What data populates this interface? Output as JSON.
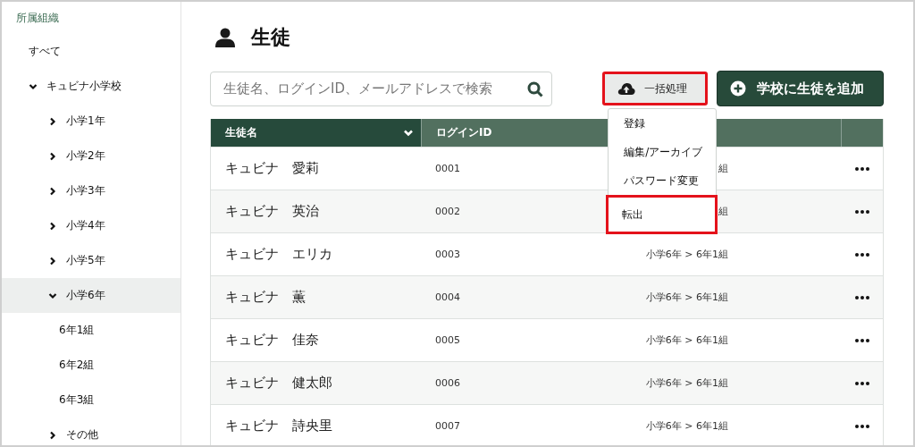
{
  "sidebar": {
    "heading": "所属組織",
    "tree": [
      {
        "label": "すべて",
        "selected": false
      },
      {
        "label": "キュビナ小学校",
        "expanded": true,
        "selected": false,
        "children": [
          {
            "label": "小学1年",
            "expanded": false,
            "selected": false
          },
          {
            "label": "小学2年",
            "expanded": false,
            "selected": false
          },
          {
            "label": "小学3年",
            "expanded": false,
            "selected": false
          },
          {
            "label": "小学4年",
            "expanded": false,
            "selected": false
          },
          {
            "label": "小学5年",
            "expanded": false,
            "selected": false
          },
          {
            "label": "小学6年",
            "expanded": true,
            "selected": true,
            "children": [
              {
                "label": "6年1組",
                "selected": false
              },
              {
                "label": "6年2組",
                "selected": false
              },
              {
                "label": "6年3組",
                "selected": false
              }
            ]
          },
          {
            "label": "その他",
            "expanded": false,
            "selected": false
          }
        ]
      }
    ]
  },
  "page": {
    "title": "生徒"
  },
  "search": {
    "placeholder": "生徒名、ログインID、メールアドレスで検索"
  },
  "bulk_button": {
    "label": "一括処理",
    "highlighted": true
  },
  "bulk_menu": [
    {
      "label": "登録",
      "highlighted": false
    },
    {
      "label": "編集/アーカイブ",
      "highlighted": false
    },
    {
      "label": "パスワード変更",
      "highlighted": false
    },
    {
      "label": "転出",
      "highlighted": true
    }
  ],
  "add_button": {
    "label": "学校に生徒を追加"
  },
  "table": {
    "columns": [
      {
        "label": "生徒名",
        "selected": true
      },
      {
        "label": "ログインID",
        "selected": false
      },
      {
        "selected": false
      },
      {
        "selected": false
      }
    ],
    "rows": [
      {
        "name": "キュビナ　愛莉",
        "login_id": "0001",
        "column_3": "組"
      },
      {
        "name": "キュビナ　英治",
        "login_id": "0002",
        "column_3": "組"
      },
      {
        "name": "キュビナ　エリカ",
        "login_id": "0003",
        "column_3": "小学6年 > 6年1組"
      },
      {
        "name": "キュビナ　薫",
        "login_id": "0004",
        "column_3": "小学6年 > 6年1組"
      },
      {
        "name": "キュビナ　佳奈",
        "login_id": "0005",
        "column_3": "小学6年 > 6年1組"
      },
      {
        "name": "キュビナ　健太郎",
        "login_id": "0006",
        "column_3": "小学6年 > 6年1組"
      },
      {
        "name": "キュビナ　詩央里",
        "login_id": "0007",
        "column_3": "小学6年 > 6年1組"
      }
    ]
  }
}
